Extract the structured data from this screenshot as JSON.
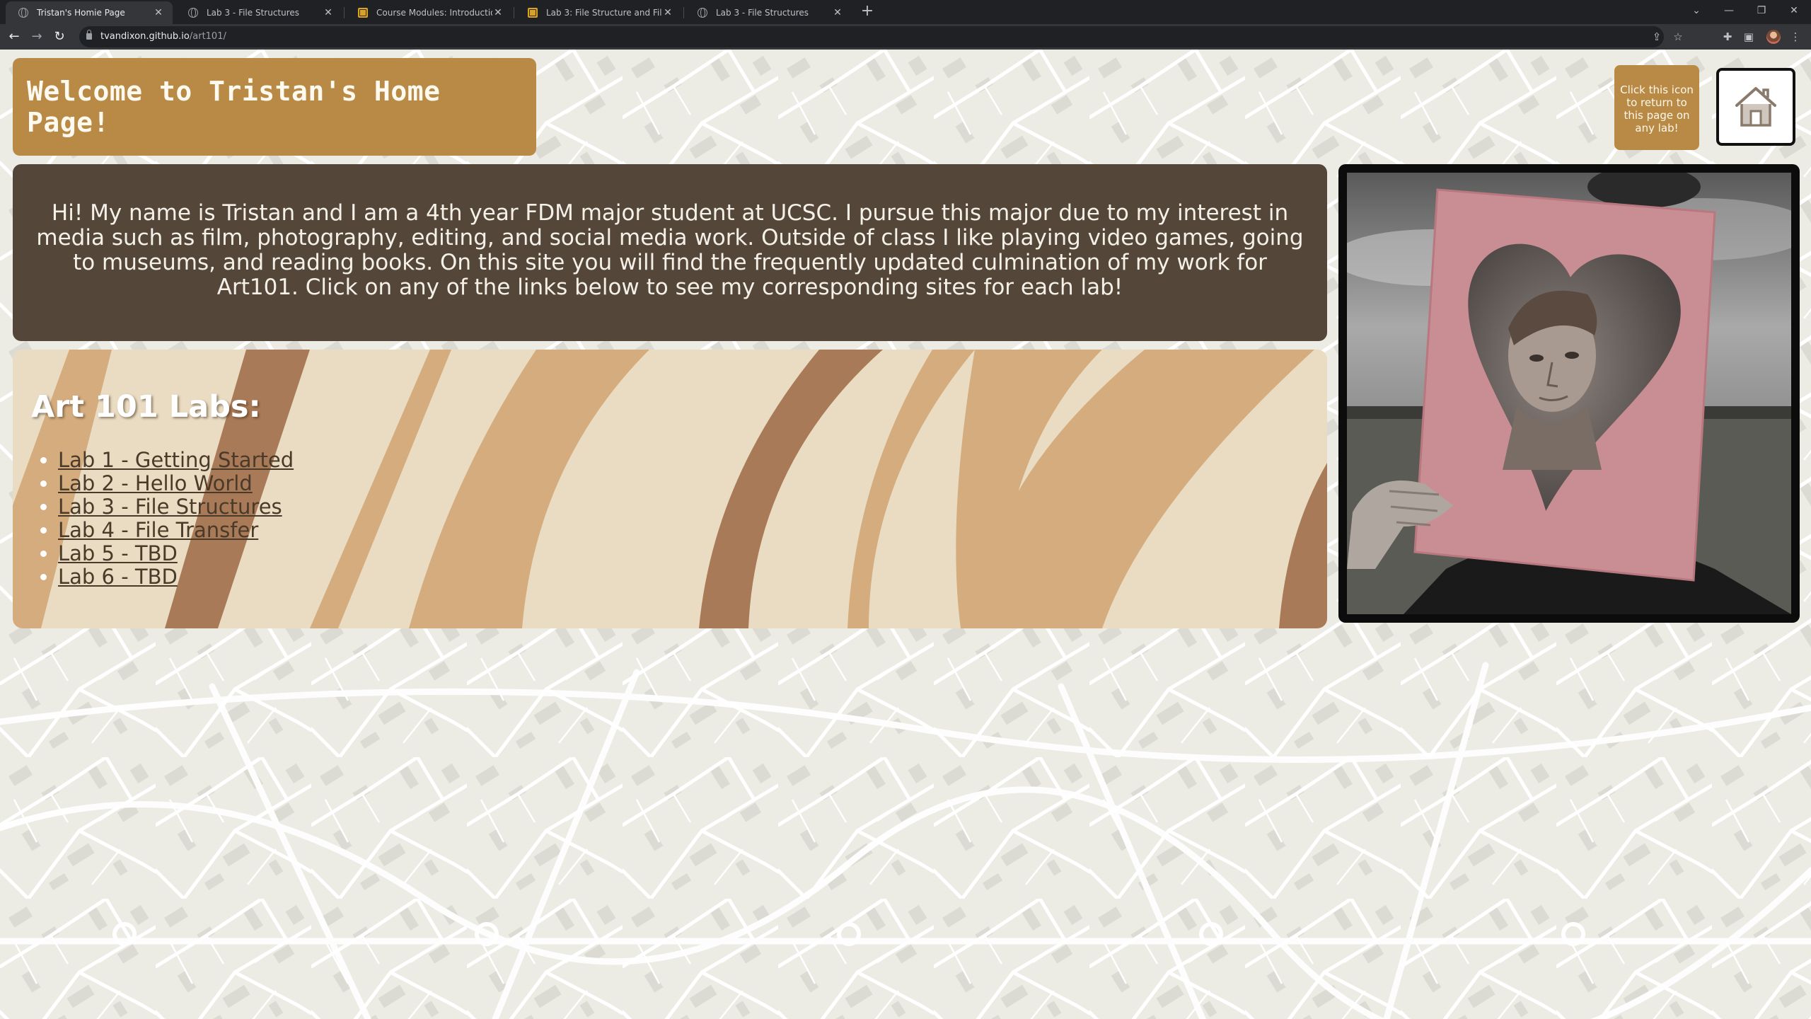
{
  "browser": {
    "tabs": [
      {
        "title": "Tristan's Homie Page",
        "icon": "globe-icon",
        "active": true
      },
      {
        "title": "Lab 3 - File Structures",
        "icon": "globe-icon",
        "active": false
      },
      {
        "title": "Course Modules: Introduction to",
        "icon": "canvas-icon",
        "active": false
      },
      {
        "title": "Lab 3: File Structure and File Tran",
        "icon": "canvas-icon",
        "active": false
      },
      {
        "title": "Lab 3 - File Structures",
        "icon": "globe-icon",
        "active": false
      }
    ],
    "url_host": "tvandixon.github.io",
    "url_path": "/art101/"
  },
  "header": {
    "title": "Welcome to Tristan's Home Page!",
    "home_tip": "Click this icon to return to this page on any lab!"
  },
  "intro": {
    "text": "Hi! My name is Tristan and I am a 4th year FDM major student at UCSC. I pursue this major due to my interest in media such as film, photography, editing, and social media work. Outside of class I like playing video games, going to museums, and reading books. On this site you will find the frequently updated culmination of my work for Art101. Click on any of the links below to see my corresponding sites for each lab!"
  },
  "labs": {
    "heading": "Art 101 Labs:",
    "links": [
      "Lab 1 - Getting Started",
      "Lab 2 - Hello World",
      "Lab 3 - File Structures",
      "Lab 4 - File Transfer",
      "Lab 5 - TBD",
      "Lab 6 - TBD"
    ]
  },
  "colors": {
    "header_bg": "#b88a45",
    "intro_bg": "#54473a",
    "page_bg": "#ecebe4"
  }
}
